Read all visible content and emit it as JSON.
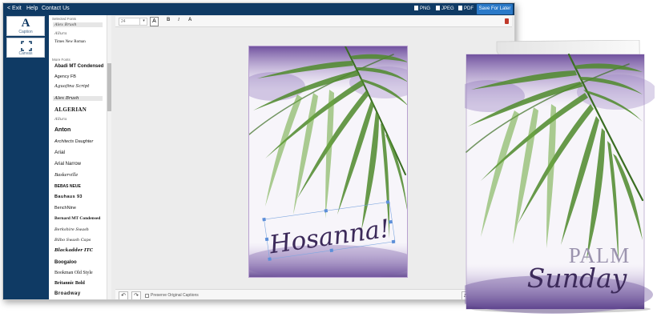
{
  "topbar": {
    "exit": "< Exit",
    "help": "Help",
    "contact": "Contact Us",
    "export_png": "PNG",
    "export_jpeg": "JPEG",
    "export_pdf": "PDF",
    "save": "Save For Later"
  },
  "tools": {
    "caption": "Caption",
    "caption_glyph": "A",
    "canvas": "Canvas"
  },
  "fonts": {
    "selected_header": "Selected Fonts",
    "selected": [
      "Alex Brush",
      "Allura",
      "Times New Roman"
    ],
    "more_header": "More Fonts",
    "more": [
      "Abadi MT Condensed",
      "Agency FB",
      "Aguafina Script",
      "Alex Brush",
      "ALGERIAN",
      "Allura",
      "Anton",
      "Architects Daughter",
      "Arial",
      "Arial Narrow",
      "Baskerville",
      "BEBAS NEUE",
      "Bauhaus 93",
      "BenchNine",
      "Bernard MT Condensed",
      "Berkshire Swash",
      "Bilbo Swash Caps",
      "Blackadder ITC",
      "Boogaloo",
      "Bookman Old Style",
      "Britannic Bold",
      "Broadway"
    ]
  },
  "toolbar": {
    "font_size": "24",
    "dropdown": "▾",
    "color_glyph": "A",
    "bold": "B",
    "italic": "I",
    "text_a": "A"
  },
  "bottombar": {
    "undo": "↶",
    "redo": "↷",
    "preserve": "Preserve Original Captions",
    "zoom": "Zoo"
  },
  "card_left": {
    "caption": "Hosanna!"
  },
  "card_right": {
    "line1": "PALM",
    "line2": "Sunday"
  },
  "colors": {
    "navy": "#0f3a64",
    "save_blue": "#2a79c8",
    "purple_text": "#3c2a5a",
    "palm_grey": "#9b93ae",
    "leaf_green": "#3f7f25"
  },
  "icons": [
    "exit-icon",
    "png-icon",
    "jpeg-icon",
    "pdf-icon",
    "trash-icon",
    "undo-icon",
    "redo-icon",
    "canvas-icon"
  ]
}
